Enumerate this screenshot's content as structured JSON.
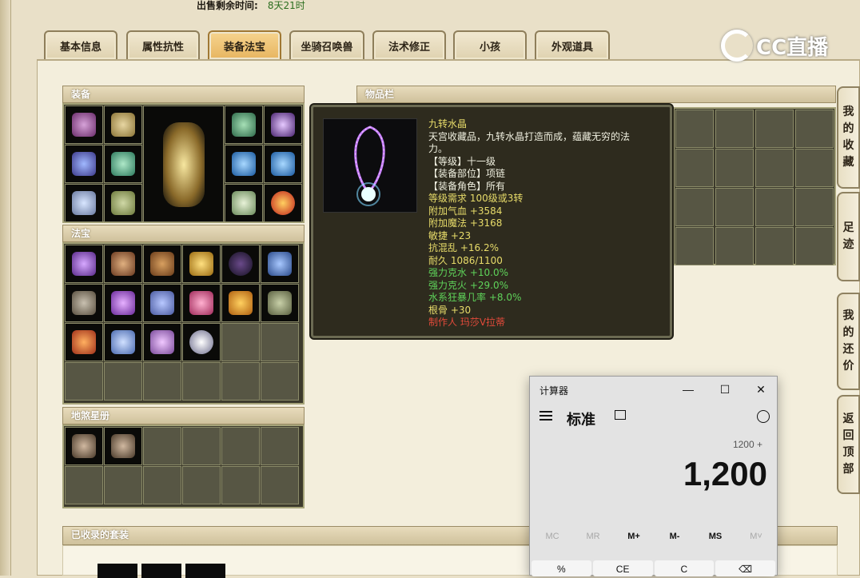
{
  "header": {
    "sale_time_label": "出售剩余时间:",
    "sale_time_value": "8天21时"
  },
  "tabs": [
    {
      "label": "基本信息",
      "active": false
    },
    {
      "label": "属性抗性",
      "active": false
    },
    {
      "label": "装备法宝",
      "active": true
    },
    {
      "label": "坐骑召唤兽",
      "active": false
    },
    {
      "label": "法术修正",
      "active": false
    },
    {
      "label": "小孩",
      "active": false
    },
    {
      "label": "外观道具",
      "active": false
    }
  ],
  "logo": {
    "text": "CC直播"
  },
  "sections": {
    "equipment": "装备",
    "fabao": "法宝",
    "disha": "地煞星册",
    "inventory": "物品栏",
    "suits": "已收录的套装"
  },
  "tooltip": {
    "icon": "crystal-necklace-icon",
    "name": "九转水晶",
    "desc_1": "天宫收藏品，九转水晶打造而成，蕴藏无穷的法",
    "desc_2": "力。",
    "level": "【等级】十一级",
    "slot": "【装备部位】项链",
    "role": "【装备角色】所有",
    "req": "等级需求 100级或3转",
    "hp": "附加气血 +3584",
    "mp": "附加魔法 +3168",
    "agi": "敏捷 +23",
    "chaos": "抗混乱 +16.2%",
    "durability": "耐久 1086/1100",
    "water": "强力克水 +10.0%",
    "fire": "强力克火 +29.0%",
    "rage": "水系狂暴几率 +8.0%",
    "root": "根骨 +30",
    "maker": "制作人 玛莎V拉蒂",
    "colors": {
      "yellow": "#e8dc6a",
      "white": "#f0f0e0",
      "green": "#5fd35a",
      "red": "#e04a3a"
    }
  },
  "side_buttons": [
    {
      "chars": [
        "我",
        "的",
        "收",
        "藏"
      ]
    },
    {
      "chars": [
        "足",
        "迹"
      ]
    },
    {
      "chars": [
        "我",
        "的",
        "还",
        "价"
      ]
    },
    {
      "chars": [
        "返",
        "回",
        "顶",
        "部"
      ]
    }
  ],
  "calculator": {
    "title": "计算器",
    "minimize": "—",
    "maximize": "☐",
    "close": "✕",
    "mode": "标准",
    "mode_icon": "keep-on-top-icon",
    "history_icon": "history-icon",
    "expression": "1200 +",
    "display": "1,200",
    "memory": [
      "MC",
      "MR",
      "M+",
      "M-",
      "MS",
      "M˅"
    ],
    "keys": [
      "%",
      "CE",
      "C",
      "⌫"
    ]
  }
}
